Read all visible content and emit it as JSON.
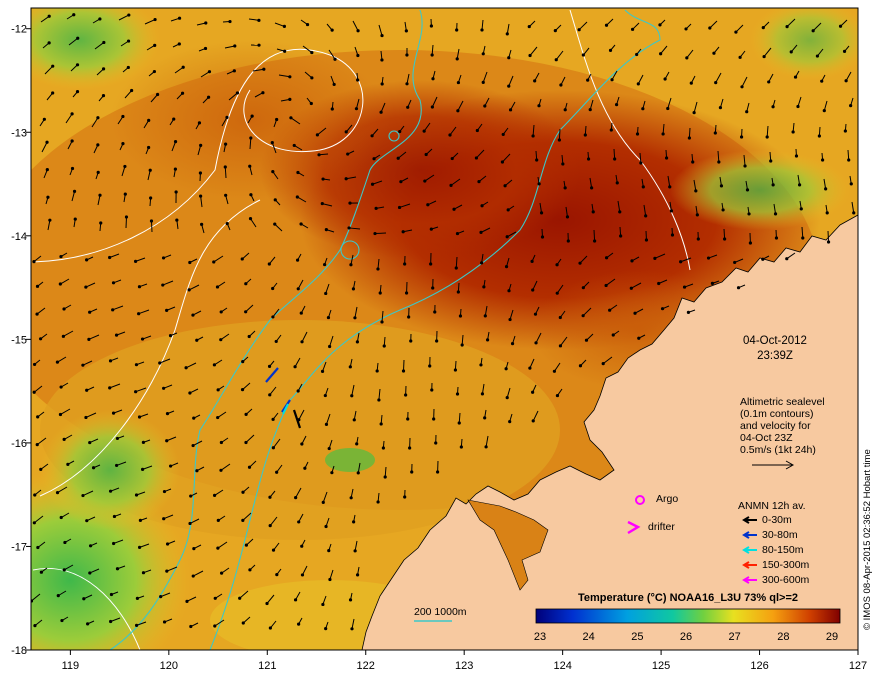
{
  "map": {
    "x_ticks": [
      "119",
      "120",
      "121",
      "122",
      "123",
      "124",
      "125",
      "126",
      "127"
    ],
    "y_ticks": [
      "-12",
      "-13",
      "-14",
      "-15",
      "-16",
      "-17",
      "-18"
    ],
    "lon_range": [
      118.6,
      127.0
    ],
    "lat_range": [
      -18.0,
      -11.8
    ]
  },
  "timestamp": {
    "date": "04-Oct-2012",
    "time": "23:39Z"
  },
  "altimetry_note": {
    "line1": "Altimetric sealevel",
    "line2": "(0.1m contours)",
    "line3": "and velocity for",
    "line4": "04-Oct 23Z",
    "line5": "0.5m/s (1kt 24h)"
  },
  "markers": {
    "argo": "Argo",
    "drifter": "drifter"
  },
  "anmn": {
    "title": "ANMN 12h av.",
    "items": [
      {
        "label": "0-30m",
        "color": "#000000"
      },
      {
        "label": "30-80m",
        "color": "#0033cc"
      },
      {
        "label": "80-150m",
        "color": "#00e0e0"
      },
      {
        "label": "150-300m",
        "color": "#ff2000"
      },
      {
        "label": "300-600m",
        "color": "#ff00ff"
      }
    ]
  },
  "depth_legend": {
    "label": "200  1000m",
    "color": "#3cc8c8"
  },
  "colorbar": {
    "title": "Temperature (°C) NOAA16_L3U 73% ql>=2",
    "ticks": [
      "23",
      "24",
      "25",
      "26",
      "27",
      "28",
      "29"
    ]
  },
  "credit": "© IMOS 08-Apr-2015 02:36:52 Hobart time",
  "colors": {
    "land": "#f7c9a0",
    "sst_warm": "#a01f00",
    "sst_mid": "#d97a10",
    "sst_cool": "#e8b820",
    "sst_cold": "#7ac830"
  }
}
